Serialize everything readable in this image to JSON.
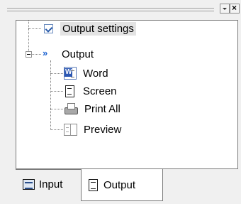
{
  "window": {
    "dropdown_icon": "chevron-down-icon",
    "close_icon": "close-icon",
    "close_glyph": "×"
  },
  "tree": {
    "root": {
      "label": "Output settings",
      "icon": "checkbox-icon",
      "selected": true
    },
    "group": {
      "label": "Output",
      "icon": "double-chevron-icon",
      "chevron_glyph": "»",
      "expanded": true,
      "children": [
        {
          "label": "Word",
          "icon": "word-document-icon"
        },
        {
          "label": "Screen",
          "icon": "document-icon"
        },
        {
          "label": "Print All",
          "icon": "printer-icon"
        },
        {
          "label": "Preview",
          "icon": "print-preview-icon"
        }
      ]
    }
  },
  "tabs": [
    {
      "label": "Input",
      "icon": "input-form-icon",
      "active": false
    },
    {
      "label": "Output",
      "icon": "output-document-icon",
      "active": true
    }
  ]
}
